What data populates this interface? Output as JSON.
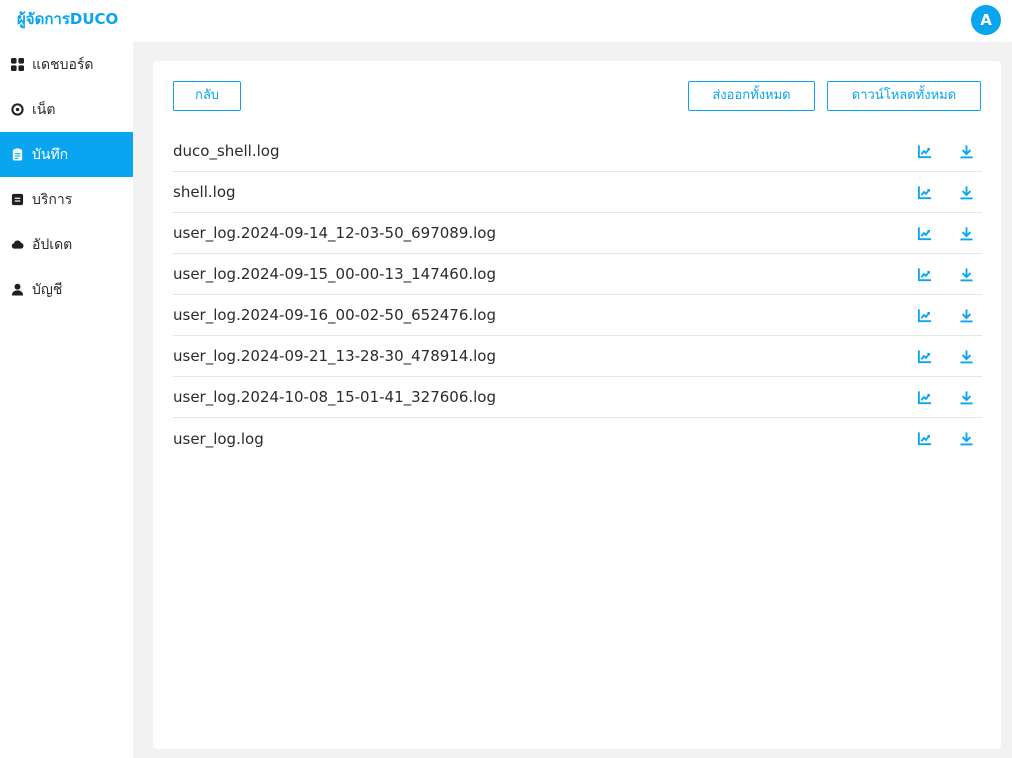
{
  "app": {
    "brand": "ผู้จัดการDUCO",
    "avatar_initial": "A",
    "accent_color": "#0aa5f0"
  },
  "sidebar": {
    "items": [
      {
        "label": "แดชบอร์ด",
        "icon": "grid-icon",
        "active": false
      },
      {
        "label": "เน็ต",
        "icon": "target-icon",
        "active": false
      },
      {
        "label": "บันทึก",
        "icon": "clipboard-icon",
        "active": true
      },
      {
        "label": "บริการ",
        "icon": "list-box-icon",
        "active": false
      },
      {
        "label": "อัปเดต",
        "icon": "cloud-icon",
        "active": false
      },
      {
        "label": "บัญชี",
        "icon": "user-icon",
        "active": false
      }
    ]
  },
  "toolbar": {
    "back_label": "กลับ",
    "export_all_label": "ส่งออกทั้งหมด",
    "download_all_label": "ดาวน์โหลดทั้งหมด"
  },
  "files": [
    {
      "name": "duco_shell.log"
    },
    {
      "name": "shell.log"
    },
    {
      "name": "user_log.2024-09-14_12-03-50_697089.log"
    },
    {
      "name": "user_log.2024-09-15_00-00-13_147460.log"
    },
    {
      "name": "user_log.2024-09-16_00-02-50_652476.log"
    },
    {
      "name": "user_log.2024-09-21_13-28-30_478914.log"
    },
    {
      "name": "user_log.2024-10-08_15-01-41_327606.log"
    },
    {
      "name": "user_log.log"
    }
  ]
}
